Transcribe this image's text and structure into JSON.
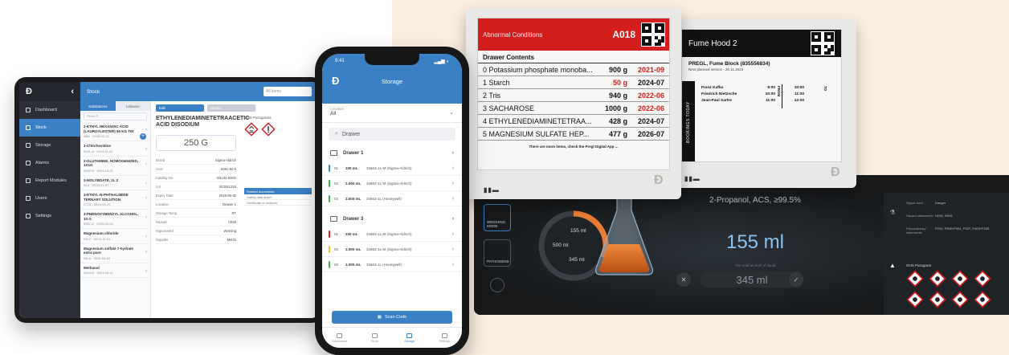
{
  "tablet": {
    "logo": "Ð",
    "nav": [
      {
        "label": "Dashboard",
        "active": false
      },
      {
        "label": "Stock",
        "active": true
      },
      {
        "label": "Storage",
        "active": false
      },
      {
        "label": "Alarms",
        "active": false
      },
      {
        "label": "Report Modules",
        "active": false
      },
      {
        "label": "Users",
        "active": false
      },
      {
        "label": "Settings",
        "active": false
      }
    ],
    "header_title": "Stock",
    "search_placeholder": "All items",
    "list_tabs": [
      "Substances",
      "Labware"
    ],
    "list_search": "Search",
    "list_items": [
      {
        "name": "2-ETHYL HEXANOIC ACID (LAUROYLESTER) 50 KG TIN",
        "sub": "N8A · 2025-03-12"
      },
      {
        "name": "1-Chlorhexidine",
        "sub": "0091-A · 2024-11-03"
      },
      {
        "name": "2-GLUTAMINE, HOMOGENIZED, 1X1G",
        "sub": "0092-B · 2024-10-21"
      },
      {
        "name": "2-MOLYBDATE, 1L 2",
        "sub": "N14 · 2025-01-07"
      },
      {
        "name": "3-ETHYL-N-PHTHALIMIDE TERNARY SOLUTION",
        "sub": "C7-D · 2024-09-29"
      },
      {
        "name": "3-PHENOXYBENZYL ALCOHOL, 10 G",
        "sub": "0087-A · 2025-02-14"
      },
      {
        "name": "Magnesium chloride",
        "sub": "N3-C · 2024-12-01"
      },
      {
        "name": "Magnesium sulfate 7-hydrate extra pure",
        "sub": "N9-A · 2025-04-18"
      },
      {
        "name": "Methanol",
        "sub": "0044-B · 2024-08-11"
      }
    ],
    "actions": [
      "Edit",
      "History"
    ],
    "chem_title": "ETHYLENEDIAMINETETRAACETIC ACID DISODIUM",
    "ghs_label": "GHS Pictograms",
    "amount": "250 G",
    "props": [
      {
        "k": "Brand",
        "v": "Sigma-Aldrich"
      },
      {
        "k": "CAS",
        "v": "6381-92-6"
      },
      {
        "k": "Catalog No.",
        "v": "E5134-500G"
      },
      {
        "k": "Lot",
        "v": "BCBX1234"
      },
      {
        "k": "Expiry Date",
        "v": "2025-06-30"
      },
      {
        "k": "Location",
        "v": "Drawer 1"
      },
      {
        "k": "Storage Temp.",
        "v": "RT"
      },
      {
        "k": "Hazard",
        "v": "H332"
      },
      {
        "k": "Signal word",
        "v": "Warning"
      },
      {
        "k": "Supplier",
        "v": "Merck"
      }
    ],
    "side_card": {
      "header": "Related documents",
      "rows": [
        "Safety data sheet",
        "Certificate of analysis"
      ]
    }
  },
  "phone": {
    "time": "9:41",
    "signal": "▂▄▆ ◗",
    "logo": "Ð",
    "title": "Storage",
    "filter_label": "Location",
    "filter_value": "All",
    "search": "Drawer",
    "groups": [
      {
        "name": "Drawer 1",
        "rows": [
          {
            "slot": "01",
            "amt": "100 mL",
            "desc": "34663-1L-M (Sigma-Aldrich)",
            "color": "#3b7fc4"
          },
          {
            "slot": "02",
            "amt": "2.000 mL",
            "desc": "34663-1L-M (Sigma-Aldrich)",
            "color": "#3bb54a"
          },
          {
            "slot": "03",
            "amt": "2.000 mL",
            "desc": "34663-1L (Honeywell)",
            "color": "#3bb54a"
          }
        ]
      },
      {
        "name": "Drawer 3",
        "rows": [
          {
            "slot": "01",
            "amt": "100 mL",
            "desc": "34663-1L-M (Sigma-Aldrich)",
            "color": "#d41e1e"
          },
          {
            "slot": "02",
            "amt": "2.000 mL",
            "desc": "34663-1L-M (Sigma-Aldrich)",
            "color": "#f2c230"
          },
          {
            "slot": "03",
            "amt": "2.000 mL",
            "desc": "34663-1L (Honeywell)",
            "color": "#3bb54a"
          }
        ]
      }
    ],
    "scan_label": "Scan Code",
    "tabs": [
      {
        "label": "Dashboard",
        "active": false
      },
      {
        "label": "Stock",
        "active": false
      },
      {
        "label": "Storage",
        "active": true
      },
      {
        "label": "Settings",
        "active": false
      }
    ]
  },
  "label1": {
    "header": "Abnormal Conditions",
    "code": "A018",
    "subtitle": "Drawer Contents",
    "rows": [
      {
        "name": "0 Potassium phosphate monoba...",
        "weight": "900 g",
        "date": "2021-09",
        "weight_red": false,
        "date_red": true
      },
      {
        "name": "1 Starch",
        "weight": "50 g",
        "date": "2024-07",
        "weight_red": true,
        "date_red": false
      },
      {
        "name": "2 Tris",
        "weight": "940 g",
        "date": "2022-06",
        "weight_red": false,
        "date_red": true
      },
      {
        "name": "3 SACHAROSE",
        "weight": "1000 g",
        "date": "2022-06",
        "weight_red": false,
        "date_red": true
      },
      {
        "name": "4 ETHYLENEDIAMINETETRAA...",
        "weight": "428 g",
        "date": "2024-07",
        "weight_red": false,
        "date_red": false
      },
      {
        "name": "5 MAGNESIUM SULFATE HEP...",
        "weight": "477 g",
        "date": "2026-07",
        "weight_red": false,
        "date_red": false
      }
    ],
    "footer": "There are more items, check the Pregl Digital App ...",
    "brand": "Ð",
    "indicator": "▮▮▬"
  },
  "label2": {
    "header": "Fume Hood 2",
    "title": "PREGL, Fume Block (835556834)",
    "service": "Next planned service - 20.11.2023",
    "bookings_label": "BOOKINGS TODAY",
    "from_label": "FROM",
    "to_label": "TO",
    "rows": [
      {
        "name": "Franz Kafka",
        "from": "9:00",
        "to": "10:00"
      },
      {
        "name": "Friedrich Nietzsche",
        "from": "10:00",
        "to": "11:00"
      },
      {
        "name": "Jean-Paul Sartre",
        "from": "11:00",
        "to": "12:00"
      }
    ],
    "brand": "Ð",
    "indicator": "▮▮▬"
  },
  "dark_panel": {
    "modes": [
      "WEIGHING MODE",
      "PATHOGENS"
    ],
    "gauge": {
      "top": "155 ml",
      "mid": "500 ml",
      "bottom": "345 ml",
      "fill_fraction": 0.31
    },
    "readout": "2-Propanol, ACS, ≥99.5%",
    "big_value": "155 ml",
    "small_caption": "The total amount of liquid",
    "input_value": "345 ml",
    "cancel_symbol": "✕",
    "confirm_symbol": "✓",
    "info": [
      {
        "k": "Signal word",
        "v": "Danger"
      },
      {
        "k": "Hazard statements",
        "v": "H225, H319"
      },
      {
        "k": "Precautionary statements",
        "v": "P210, P305+P351, P337, P403+P235"
      }
    ],
    "ghs_header": "GHS Pictogram",
    "colors": {
      "accent": "#3b7fc4",
      "flask_liquid": "#e97c35"
    }
  }
}
